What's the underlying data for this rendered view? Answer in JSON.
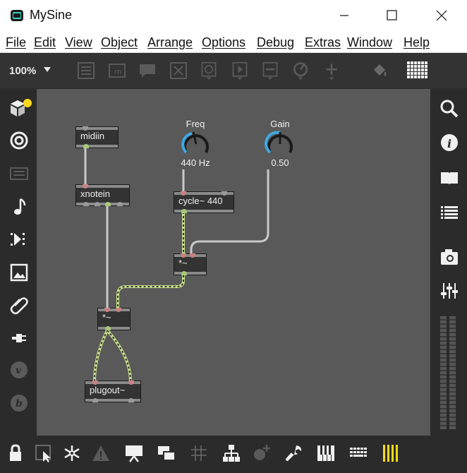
{
  "window": {
    "title": "MySine"
  },
  "menu": [
    "File",
    "Edit",
    "View",
    "Object",
    "Arrange",
    "Options",
    "Debug",
    "Extras",
    "Window",
    "Help"
  ],
  "toolbar": {
    "zoom": "100%"
  },
  "objects": {
    "midiin": "midiin",
    "xnotein": "xnotein",
    "cycle": "cycle~ 440",
    "mult1": "*~",
    "mult2": "*~",
    "plugout": "plugout~"
  },
  "dials": {
    "freq": {
      "label": "Freq",
      "value": "440 Hz"
    },
    "gain": {
      "label": "Gain",
      "value": "0.50"
    }
  },
  "colors": {
    "accent": "#ffd91a",
    "dial_arc": "#3fa8e0",
    "signal_patch": "#c8e08a",
    "control_patch": "#c9c9c9",
    "inlet": "#c98282",
    "outlet": "#a8c878",
    "canvas": "#595959"
  }
}
